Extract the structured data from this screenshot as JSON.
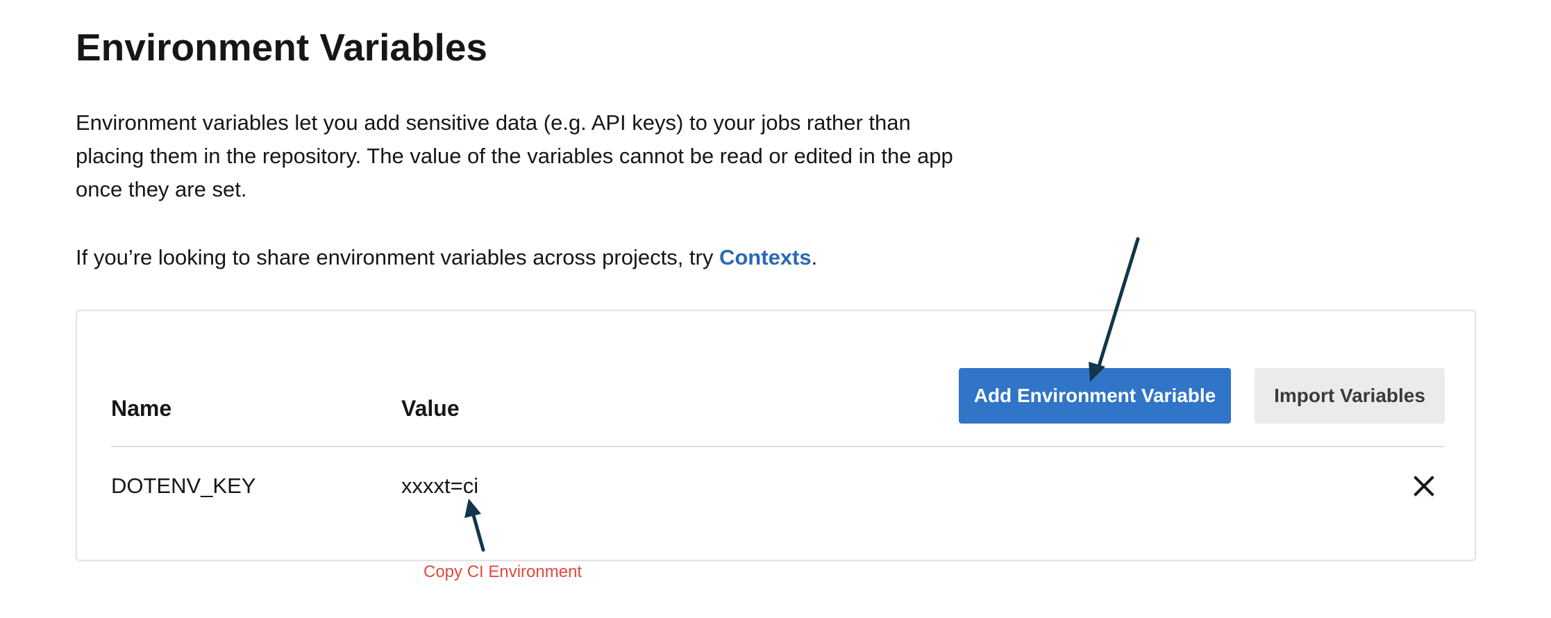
{
  "page": {
    "title": "Environment Variables",
    "description": "Environment variables let you add sensitive data (e.g. API keys) to your jobs rather than placing them in the repository. The value of the variables cannot be read or edited in the app once they are set.",
    "contexts_prefix": "If you’re looking to share environment variables across projects, try ",
    "contexts_link": "Contexts",
    "contexts_suffix": "."
  },
  "table": {
    "columns": {
      "name": "Name",
      "value": "Value"
    },
    "buttons": {
      "add": "Add Environment Variable",
      "import": "Import Variables"
    },
    "rows": [
      {
        "name": "DOTENV_KEY",
        "value": "xxxxt=ci"
      }
    ]
  },
  "annotations": {
    "copy_label": "Copy CI Environment"
  },
  "icons": {
    "delete": "close-icon",
    "arrows": "arrow-icon"
  },
  "colors": {
    "primary": "#3075c7",
    "link": "#2a6ab7",
    "annotation_text": "#e2493a",
    "arrow": "#12364a"
  }
}
